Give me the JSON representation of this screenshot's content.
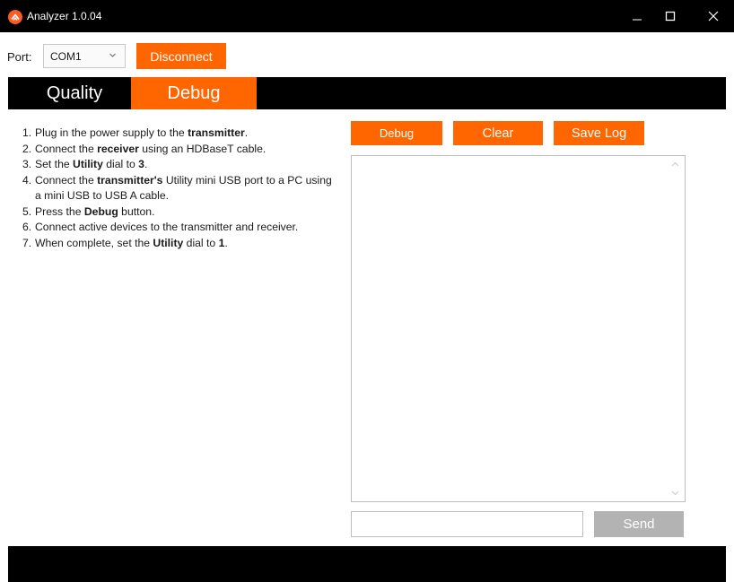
{
  "window": {
    "title": "Analyzer 1.0.04",
    "icon": "analyzer-logo-icon",
    "controls": [
      "minimize-icon",
      "maximize-icon",
      "close-icon"
    ]
  },
  "port": {
    "label": "Port:",
    "selected": "COM1",
    "disconnect_label": "Disconnect"
  },
  "tabs": [
    {
      "label": "Quality",
      "active": false
    },
    {
      "label": "Debug",
      "active": true
    }
  ],
  "instructions": [
    {
      "num": "1.",
      "parts": [
        {
          "t": "Plug in the power supply to the "
        },
        {
          "t": "transmitter",
          "b": true
        },
        {
          "t": "."
        }
      ]
    },
    {
      "num": "2.",
      "parts": [
        {
          "t": "Connect the "
        },
        {
          "t": "receiver",
          "b": true
        },
        {
          "t": " using an HDBaseT cable."
        }
      ]
    },
    {
      "num": "3.",
      "parts": [
        {
          "t": "Set the "
        },
        {
          "t": "Utility",
          "b": true
        },
        {
          "t": " dial to "
        },
        {
          "t": "3",
          "b": true
        },
        {
          "t": "."
        }
      ]
    },
    {
      "num": "4.",
      "parts": [
        {
          "t": "Connect the "
        },
        {
          "t": "transmitter's",
          "b": true
        },
        {
          "t": " Utility mini USB port to a PC using a mini USB to USB A cable."
        }
      ]
    },
    {
      "num": "5.",
      "parts": [
        {
          "t": "Press the "
        },
        {
          "t": "Debug",
          "b": true
        },
        {
          "t": " button."
        }
      ]
    },
    {
      "num": "6.",
      "parts": [
        {
          "t": "Connect active devices to the transmitter and receiver."
        }
      ]
    },
    {
      "num": "7.",
      "parts": [
        {
          "t": "When complete, set the "
        },
        {
          "t": "Utility",
          "b": true
        },
        {
          "t": " dial to "
        },
        {
          "t": "1",
          "b": true
        },
        {
          "t": "."
        }
      ]
    }
  ],
  "actions": {
    "debug_label": "Debug",
    "clear_label": "Clear",
    "save_log_label": "Save Log"
  },
  "log": {
    "content": ""
  },
  "send": {
    "input_value": "",
    "button_label": "Send"
  },
  "colors": {
    "accent": "#ff6600",
    "bar": "#000000",
    "disabled": "#b3b3b3"
  }
}
